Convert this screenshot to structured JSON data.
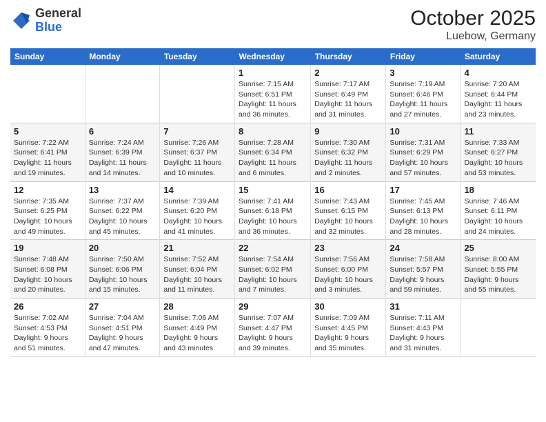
{
  "header": {
    "logo_general": "General",
    "logo_blue": "Blue",
    "month": "October 2025",
    "location": "Luebow, Germany"
  },
  "weekdays": [
    "Sunday",
    "Monday",
    "Tuesday",
    "Wednesday",
    "Thursday",
    "Friday",
    "Saturday"
  ],
  "weeks": [
    [
      {
        "day": "",
        "info": ""
      },
      {
        "day": "",
        "info": ""
      },
      {
        "day": "",
        "info": ""
      },
      {
        "day": "1",
        "info": "Sunrise: 7:15 AM\nSunset: 6:51 PM\nDaylight: 11 hours and 36 minutes."
      },
      {
        "day": "2",
        "info": "Sunrise: 7:17 AM\nSunset: 6:49 PM\nDaylight: 11 hours and 31 minutes."
      },
      {
        "day": "3",
        "info": "Sunrise: 7:19 AM\nSunset: 6:46 PM\nDaylight: 11 hours and 27 minutes."
      },
      {
        "day": "4",
        "info": "Sunrise: 7:20 AM\nSunset: 6:44 PM\nDaylight: 11 hours and 23 minutes."
      }
    ],
    [
      {
        "day": "5",
        "info": "Sunrise: 7:22 AM\nSunset: 6:41 PM\nDaylight: 11 hours and 19 minutes."
      },
      {
        "day": "6",
        "info": "Sunrise: 7:24 AM\nSunset: 6:39 PM\nDaylight: 11 hours and 14 minutes."
      },
      {
        "day": "7",
        "info": "Sunrise: 7:26 AM\nSunset: 6:37 PM\nDaylight: 11 hours and 10 minutes."
      },
      {
        "day": "8",
        "info": "Sunrise: 7:28 AM\nSunset: 6:34 PM\nDaylight: 11 hours and 6 minutes."
      },
      {
        "day": "9",
        "info": "Sunrise: 7:30 AM\nSunset: 6:32 PM\nDaylight: 11 hours and 2 minutes."
      },
      {
        "day": "10",
        "info": "Sunrise: 7:31 AM\nSunset: 6:29 PM\nDaylight: 10 hours and 57 minutes."
      },
      {
        "day": "11",
        "info": "Sunrise: 7:33 AM\nSunset: 6:27 PM\nDaylight: 10 hours and 53 minutes."
      }
    ],
    [
      {
        "day": "12",
        "info": "Sunrise: 7:35 AM\nSunset: 6:25 PM\nDaylight: 10 hours and 49 minutes."
      },
      {
        "day": "13",
        "info": "Sunrise: 7:37 AM\nSunset: 6:22 PM\nDaylight: 10 hours and 45 minutes."
      },
      {
        "day": "14",
        "info": "Sunrise: 7:39 AM\nSunset: 6:20 PM\nDaylight: 10 hours and 41 minutes."
      },
      {
        "day": "15",
        "info": "Sunrise: 7:41 AM\nSunset: 6:18 PM\nDaylight: 10 hours and 36 minutes."
      },
      {
        "day": "16",
        "info": "Sunrise: 7:43 AM\nSunset: 6:15 PM\nDaylight: 10 hours and 32 minutes."
      },
      {
        "day": "17",
        "info": "Sunrise: 7:45 AM\nSunset: 6:13 PM\nDaylight: 10 hours and 28 minutes."
      },
      {
        "day": "18",
        "info": "Sunrise: 7:46 AM\nSunset: 6:11 PM\nDaylight: 10 hours and 24 minutes."
      }
    ],
    [
      {
        "day": "19",
        "info": "Sunrise: 7:48 AM\nSunset: 6:08 PM\nDaylight: 10 hours and 20 minutes."
      },
      {
        "day": "20",
        "info": "Sunrise: 7:50 AM\nSunset: 6:06 PM\nDaylight: 10 hours and 15 minutes."
      },
      {
        "day": "21",
        "info": "Sunrise: 7:52 AM\nSunset: 6:04 PM\nDaylight: 10 hours and 11 minutes."
      },
      {
        "day": "22",
        "info": "Sunrise: 7:54 AM\nSunset: 6:02 PM\nDaylight: 10 hours and 7 minutes."
      },
      {
        "day": "23",
        "info": "Sunrise: 7:56 AM\nSunset: 6:00 PM\nDaylight: 10 hours and 3 minutes."
      },
      {
        "day": "24",
        "info": "Sunrise: 7:58 AM\nSunset: 5:57 PM\nDaylight: 9 hours and 59 minutes."
      },
      {
        "day": "25",
        "info": "Sunrise: 8:00 AM\nSunset: 5:55 PM\nDaylight: 9 hours and 55 minutes."
      }
    ],
    [
      {
        "day": "26",
        "info": "Sunrise: 7:02 AM\nSunset: 4:53 PM\nDaylight: 9 hours and 51 minutes."
      },
      {
        "day": "27",
        "info": "Sunrise: 7:04 AM\nSunset: 4:51 PM\nDaylight: 9 hours and 47 minutes."
      },
      {
        "day": "28",
        "info": "Sunrise: 7:06 AM\nSunset: 4:49 PM\nDaylight: 9 hours and 43 minutes."
      },
      {
        "day": "29",
        "info": "Sunrise: 7:07 AM\nSunset: 4:47 PM\nDaylight: 9 hours and 39 minutes."
      },
      {
        "day": "30",
        "info": "Sunrise: 7:09 AM\nSunset: 4:45 PM\nDaylight: 9 hours and 35 minutes."
      },
      {
        "day": "31",
        "info": "Sunrise: 7:11 AM\nSunset: 4:43 PM\nDaylight: 9 hours and 31 minutes."
      },
      {
        "day": "",
        "info": ""
      }
    ]
  ]
}
